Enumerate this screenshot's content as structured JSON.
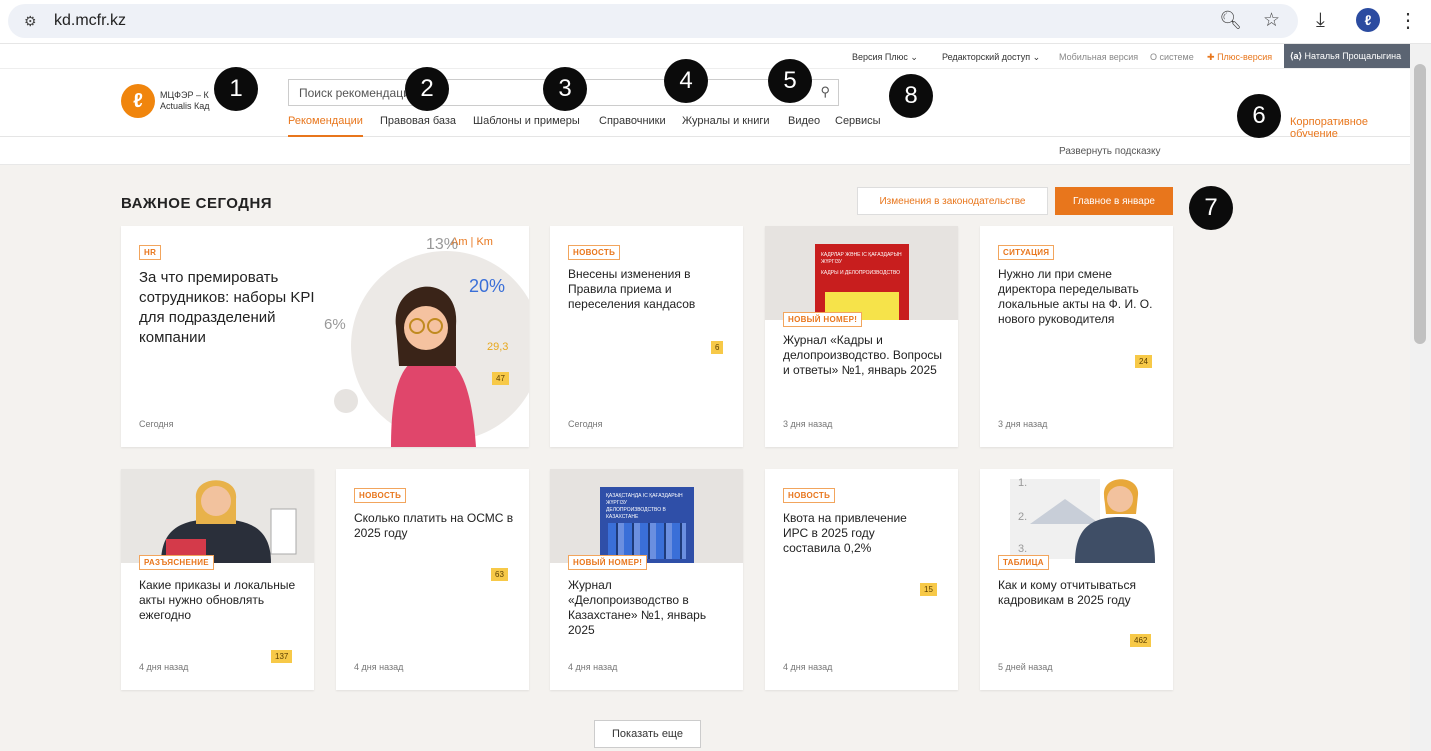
{
  "browser": {
    "url": "kd.mcfr.kz"
  },
  "top_strip": {
    "version": "Версия Плюс",
    "editor": "Редакторский доступ",
    "mobile": "Мобильная версия",
    "about": "О системе",
    "plus": "Плюс-версия",
    "user": "Наталья Прощалыгина"
  },
  "header": {
    "logo_line1": "МЦФЭР – К",
    "logo_line2": "Actualis Кад",
    "search_placeholder": "Поиск рекомендаци",
    "nav": [
      "Рекомендации",
      "Правовая база",
      "Шаблоны и примеры",
      "Справочники",
      "Журналы и книги",
      "Видео",
      "Сервисы"
    ],
    "corp": "Корпоративное обучение",
    "hint": "Развернуть подсказку"
  },
  "section": {
    "title": "ВАЖНОЕ СЕГОДНЯ",
    "btn_changes": "Изменения в законодательстве",
    "btn_main": "Главное в январе"
  },
  "cards": [
    {
      "tag": "HR",
      "title": "За что премировать сотрудников: наборы KPI для подразделений компании",
      "date": "Сегодня",
      "count": "47",
      "img_text": [
        "Am | Km",
        "13%",
        "20%",
        "6%",
        "29,3"
      ]
    },
    {
      "tag": "НОВОСТЬ",
      "title": "Внесены изменения в Правила приема и переселения кандасов",
      "date": "Сегодня",
      "count": "6"
    },
    {
      "tag": "НОВЫЙ НОМЕР!",
      "title": "Журнал «Кадры и делопроизводство. Вопросы и ответы» №1, январь 2025",
      "date": "3 дня назад",
      "img_text": [
        "КАДРЛАР ЖӘНЕ ІС ҚАҒАЗДАРЫН ЖҮРГІЗУ",
        "КАДРЫ И ДЕЛОПРОИЗВОДСТВО"
      ]
    },
    {
      "tag": "СИТУАЦИЯ",
      "title": "Нужно ли при смене директора переделывать локальные акты на Ф. И. О. нового руководителя",
      "date": "3 дня назад",
      "count": "24"
    },
    {
      "tag": "РАЗЪЯСНЕНИЕ",
      "title": "Какие приказы и локальные акты нужно обновлять ежегодно",
      "date": "4 дня назад",
      "count": "137"
    },
    {
      "tag": "НОВОСТЬ",
      "title": "Сколько платить на ОСМС в 2025 году",
      "date": "4 дня назад",
      "count": "63"
    },
    {
      "tag": "НОВЫЙ НОМЕР!",
      "title": "Журнал «Делопроизводство в Казахстане» №1, январь 2025",
      "date": "4 дня назад",
      "img_text": [
        "ҚАЗАҚСТАНДА ІС ҚАҒАЗДАРЫН ЖҮРГІЗУ",
        "ДЕЛОПРОИЗВОДСТВО В КАЗАХСТАНЕ"
      ]
    },
    {
      "tag": "НОВОСТЬ",
      "title": "Квота на привлечение ИРС в 2025 году составила 0,2%",
      "date": "4 дня назад",
      "count": "15"
    },
    {
      "tag": "ТАБЛИЦА",
      "title": "Как и кому отчитываться кадровикам в 2025 году",
      "date": "5 дней назад",
      "count": "462",
      "img_text": [
        "1.",
        "2.",
        "3."
      ]
    }
  ],
  "show_more": "Показать еще",
  "markers": [
    "1",
    "2",
    "3",
    "4",
    "5",
    "6",
    "7",
    "8"
  ],
  "colors": {
    "accent": "#e8761c",
    "badge": "#f7c948",
    "bg": "#f4f2ef"
  }
}
